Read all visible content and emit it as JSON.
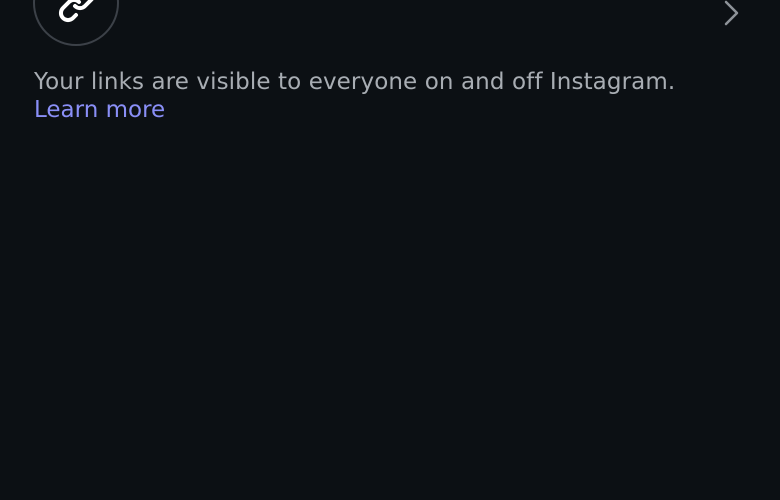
{
  "links": {
    "icon": "link-icon",
    "chevron": "chevron-right-icon",
    "visibility_notice": "Your links are visible to everyone on and off Instagram.",
    "learn_more_label": "Learn more"
  },
  "colors": {
    "background": "#0c1014",
    "text_secondary": "#a8adb3",
    "link": "#8a8ff7",
    "icon_ring": "#3c4148"
  }
}
